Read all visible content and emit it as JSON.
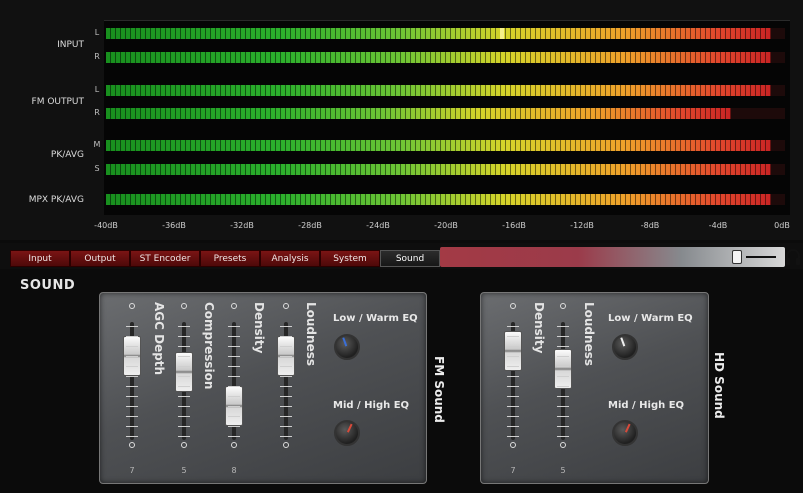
{
  "meters": {
    "groups": [
      {
        "label": "INPUT"
      },
      {
        "label": "FM OUTPUT"
      },
      {
        "label": "PK/AVG"
      },
      {
        "label": "MPX PK/AVG"
      }
    ],
    "rows": [
      {
        "channel": "L",
        "level_fraction": 0.98,
        "peak_fraction": 0.58
      },
      {
        "channel": "R",
        "level_fraction": 0.98,
        "peak_fraction": null
      },
      {
        "channel": "L",
        "level_fraction": 0.98,
        "peak_fraction": null
      },
      {
        "channel": "R",
        "level_fraction": 0.92,
        "peak_fraction": null
      },
      {
        "channel": "M",
        "level_fraction": 0.98,
        "peak_fraction": null
      },
      {
        "channel": "S",
        "level_fraction": 0.98,
        "peak_fraction": null
      },
      {
        "channel": "",
        "level_fraction": 0.98,
        "peak_fraction": null
      }
    ],
    "scale": [
      "-40dB",
      "-36dB",
      "-32dB",
      "-28dB",
      "-24dB",
      "-20dB",
      "-16dB",
      "-12dB",
      "-8dB",
      "-4dB",
      "0dB"
    ],
    "colors": {
      "low": "#2bb02c",
      "mid": "#d6d42a",
      "high": "#c92424"
    }
  },
  "tabs": [
    {
      "label": "Input",
      "active": false
    },
    {
      "label": "Output",
      "active": false
    },
    {
      "label": "ST Encoder",
      "active": false
    },
    {
      "label": "Presets",
      "active": false
    },
    {
      "label": "Analysis",
      "active": false
    },
    {
      "label": "System",
      "active": false
    },
    {
      "label": "Sound",
      "active": true
    }
  ],
  "volume": {
    "level_fraction": 0.86,
    "icon": "headphones-icon"
  },
  "section_title": "SOUND",
  "fm_sound": {
    "title": "FM Sound",
    "faders": [
      {
        "label": "AGC Depth",
        "value": "7",
        "position_fraction": 0.18
      },
      {
        "label": "Compression",
        "value": "5",
        "position_fraction": 0.38
      },
      {
        "label": "Density",
        "value": "8",
        "position_fraction": 0.82
      },
      {
        "label": "Loudness",
        "value": "",
        "position_fraction": 0.18
      }
    ],
    "knobs": [
      {
        "label": "Low / Warm EQ",
        "accent": "#3a6fd8"
      },
      {
        "label": "Mid / High EQ",
        "accent": "#d84a3a"
      }
    ]
  },
  "hd_sound": {
    "title": "HD Sound",
    "faders": [
      {
        "label": "Density",
        "value": "7",
        "position_fraction": 0.12
      },
      {
        "label": "Loudness",
        "value": "5",
        "position_fraction": 0.35
      }
    ],
    "knobs": [
      {
        "label": "Low / Warm EQ",
        "accent": "#f0f0f0"
      },
      {
        "label": "Mid / High EQ",
        "accent": "#d84a3a"
      }
    ]
  }
}
